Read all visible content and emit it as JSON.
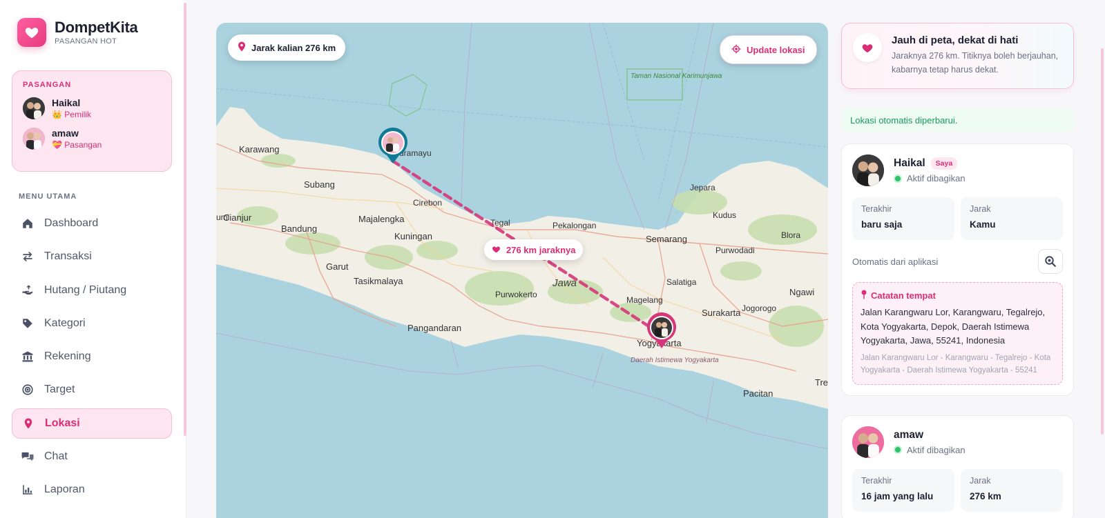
{
  "brand": {
    "name": "DompetKita",
    "subtitle": "PASANGAN HOT"
  },
  "couple": {
    "title": "PASANGAN",
    "members": [
      {
        "name": "Haikal",
        "role": "👑 Pemilik"
      },
      {
        "name": "amaw",
        "role": "💝 Pasangan"
      }
    ]
  },
  "menu": {
    "title": "MENU UTAMA",
    "items": [
      {
        "label": "Dashboard",
        "icon": "home-icon"
      },
      {
        "label": "Transaksi",
        "icon": "arrows-exchange-icon"
      },
      {
        "label": "Hutang / Piutang",
        "icon": "hand-holding-money-icon"
      },
      {
        "label": "Kategori",
        "icon": "tag-icon"
      },
      {
        "label": "Rekening",
        "icon": "bank-icon"
      },
      {
        "label": "Target",
        "icon": "target-icon"
      },
      {
        "label": "Lokasi",
        "icon": "map-pin-icon",
        "active": true
      },
      {
        "label": "Chat",
        "icon": "chat-bubbles-icon"
      },
      {
        "label": "Laporan",
        "icon": "bar-chart-icon"
      }
    ]
  },
  "map": {
    "distance_pill": "Jarak kalian 276 km",
    "update_button": "Update lokasi",
    "mid_label": "276 km jaraknya",
    "labels": {
      "karawang": "Karawang",
      "indramayu": "Indramayu",
      "subang": "Subang",
      "cirebon": "Cirebon",
      "cianjur": "Cianjur",
      "bandung": "Bandung",
      "majalengka": "Majalengka",
      "kuningan": "Kuningan",
      "garut": "Garut",
      "tasikmalaya": "Tasikmalaya",
      "tegal": "Tegal",
      "pekalongan": "Pekalongan",
      "purwokerto": "Purwokerto",
      "jawa": "Jawa",
      "pangandaran": "Pangandaran",
      "semarang": "Semarang",
      "kudus": "Kudus",
      "jepara": "Jepara",
      "purwodadi": "Purwodadi",
      "blora": "Blora",
      "salatiga": "Salatiga",
      "magelang": "Magelang",
      "surakarta": "Surakarta",
      "jogorogo": "Jogorogo",
      "ngawi": "Ngawi",
      "yogyakarta": "Yogyakarta",
      "pacitan": "Pacitan",
      "tre": "Tre",
      "umi": "umi",
      "park": "Taman Nasional Karimunjawa",
      "diy": "Daerah Istimewa Yogyakarta"
    }
  },
  "promo": {
    "title": "Jauh di peta, dekat di hati",
    "text": "Jaraknya 276 km. Titiknya boleh berjauhan, kabarnya tetap harus dekat."
  },
  "notice": "Lokasi otomatis diperbarui.",
  "users": [
    {
      "name": "Haikal",
      "badge": "Saya",
      "status": "Aktif dibagikan",
      "last_label": "Terakhir",
      "last_value": "baru saja",
      "dist_label": "Jarak",
      "dist_value": "Kamu",
      "auto_text": "Otomatis dari aplikasi",
      "note_title": "Catatan tempat",
      "note_address": "Jalan Karangwaru Lor, Karangwaru, Tegalrejo, Kota Yogyakarta, Depok, Daerah Istimewa Yogyakarta, Jawa, 55241, Indonesia",
      "note_sub": "Jalan Karangwaru Lor - Karangwaru - Tegalrejo - Kota Yogyakarta - Daerah Istimewa Yogyakarta - 55241"
    },
    {
      "name": "amaw",
      "status": "Aktif dibagikan",
      "last_label": "Terakhir",
      "last_value": "16 jam yang lalu",
      "dist_label": "Jarak",
      "dist_value": "276 km"
    }
  ],
  "colors": {
    "accent": "#d92e75",
    "accent_soft": "#fde6f0",
    "success": "#179b5a",
    "marker_teal": "#137a95"
  }
}
